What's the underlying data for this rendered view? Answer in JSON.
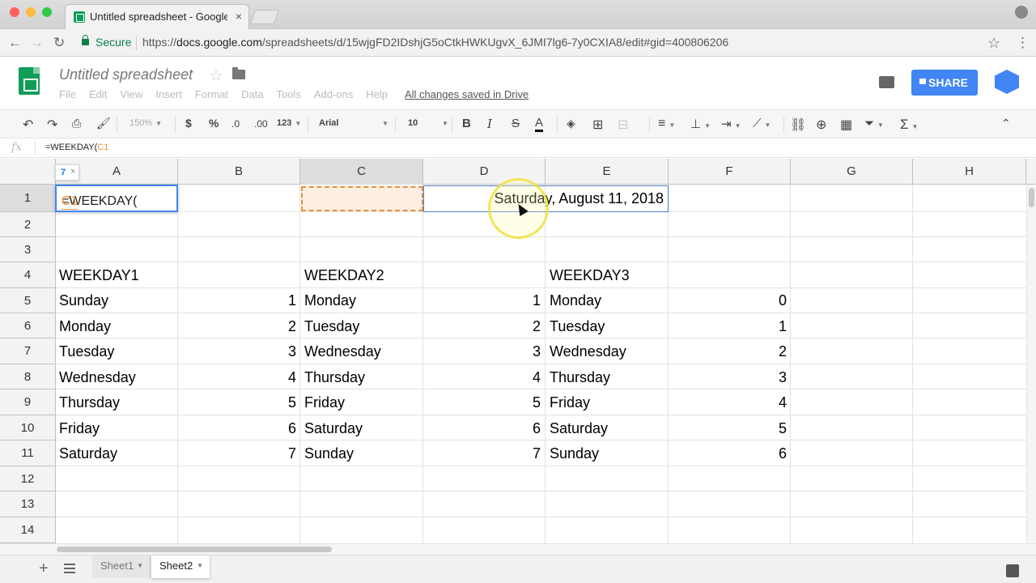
{
  "browser": {
    "tab_title": "Untitled spreadsheet - Google Sheets",
    "secure_label": "Secure",
    "url_scheme": "https://",
    "url_host": "docs.google.com",
    "url_path": "/spreadsheets/d/15wjgFD2IDshjG5oCtkHWKUgvX_6JMI7lg6-7y0CXIA8/edit#gid=400806206"
  },
  "app": {
    "doc_title": "Untitled spreadsheet",
    "menus": [
      "File",
      "Edit",
      "View",
      "Insert",
      "Format",
      "Data",
      "Tools",
      "Add-ons",
      "Help"
    ],
    "saved_status": "All changes saved in Drive",
    "share_label": "SHARE"
  },
  "toolbar": {
    "zoom": "150%",
    "currency": "$",
    "percent": "%",
    "dec_decrease": ".0",
    "dec_increase": ".00",
    "more_formats": "123",
    "font": "Arial",
    "font_size": "10"
  },
  "formula_bar": {
    "fx": "fx",
    "text_prefix": "=WEEKDAY(",
    "text_ref": "C1"
  },
  "editor": {
    "prefix": "=WEEKDAY(",
    "ref": "C1",
    "hint_number": "7",
    "hint_close": "×"
  },
  "columns": [
    "A",
    "B",
    "C",
    "D",
    "E",
    "F",
    "G",
    "H"
  ],
  "rows": [
    "1",
    "2",
    "3",
    "4",
    "5",
    "6",
    "7",
    "8",
    "9",
    "10",
    "11",
    "12",
    "13",
    "14"
  ],
  "cells": {
    "d1": "Saturday, August 11, 2018",
    "headers": [
      "WEEKDAY1",
      "WEEKDAY2",
      "WEEKDAY3"
    ],
    "col_a": [
      "Sunday",
      "Monday",
      "Tuesday",
      "Wednesday",
      "Thursday",
      "Friday",
      "Saturday"
    ],
    "col_b": [
      "1",
      "2",
      "3",
      "4",
      "5",
      "6",
      "7"
    ],
    "col_c": [
      "Monday",
      "Tuesday",
      "Wednesday",
      "Thursday",
      "Friday",
      "Saturday",
      "Sunday"
    ],
    "col_d": [
      "1",
      "2",
      "3",
      "4",
      "5",
      "6",
      "7"
    ],
    "col_e": [
      "Monday",
      "Tuesday",
      "Wednesday",
      "Thursday",
      "Friday",
      "Saturday",
      "Sunday"
    ],
    "col_f": [
      "0",
      "1",
      "2",
      "3",
      "4",
      "5",
      "6"
    ]
  },
  "sheets": {
    "tabs": [
      "Sheet1",
      "Sheet2"
    ],
    "add": "+"
  },
  "colors": {
    "accent": "#4285f4",
    "sheets_green": "#0f9d58",
    "reference_orange": "#e69138"
  }
}
